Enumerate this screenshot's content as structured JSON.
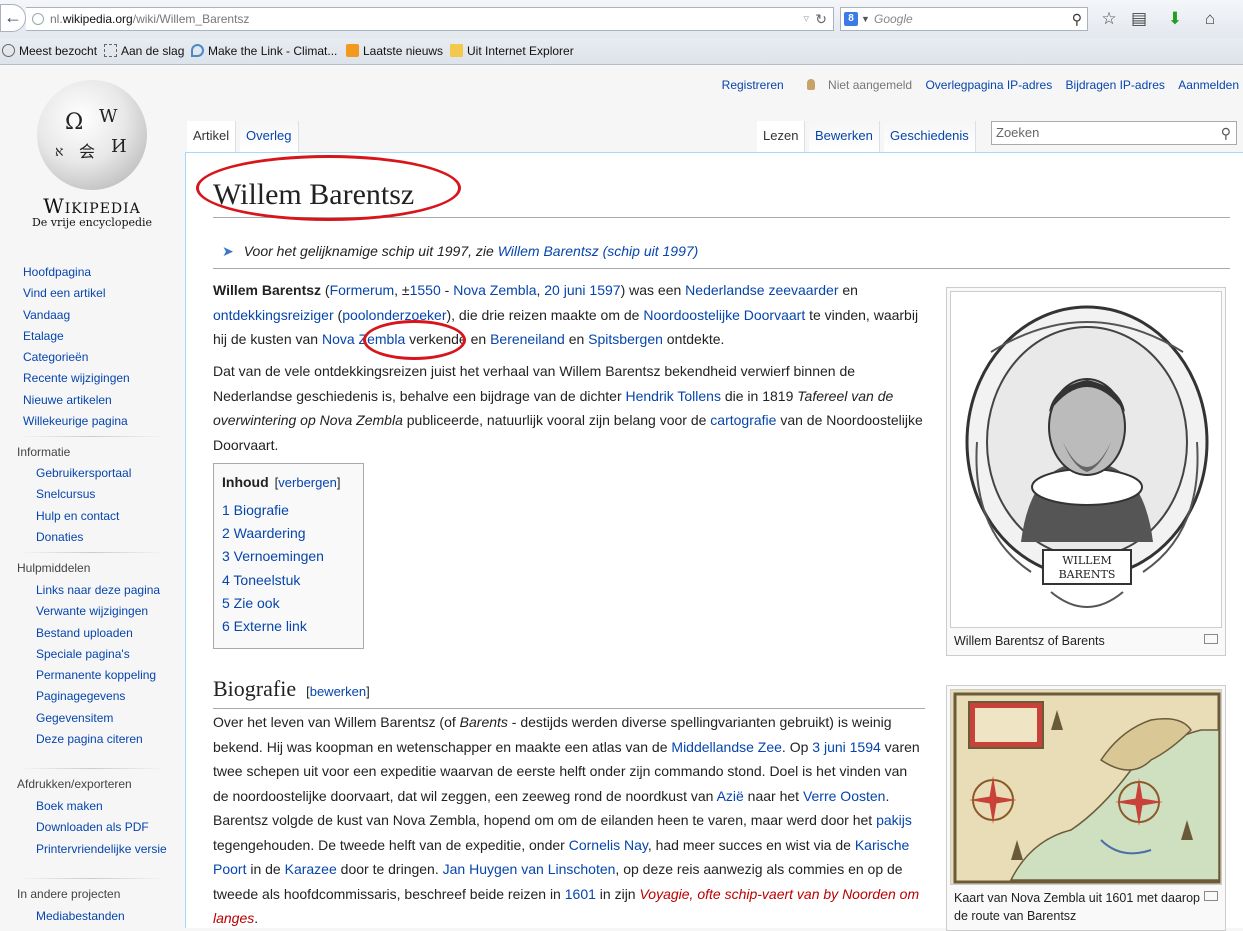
{
  "browser": {
    "url_prefix": "nl.",
    "url_host": "wikipedia.org",
    "url_path": "/wiki/Willem_Barentsz",
    "search_engine": "8",
    "search_placeholder": "Google",
    "bookmarks": [
      "Meest bezocht",
      "Aan de slag",
      "Make the Link - Climat...",
      "Laatste nieuws",
      "Uit Internet Explorer"
    ]
  },
  "logo": {
    "wordmark": "Wikipedia",
    "tagline": "De vrije encyclopedie"
  },
  "nav": {
    "main": [
      "Hoofdpagina",
      "Vind een artikel",
      "Vandaag",
      "Etalage",
      "Categorieën",
      "Recente wijzigingen",
      "Nieuwe artikelen",
      "Willekeurige pagina"
    ],
    "info_head": "Informatie",
    "info": [
      "Gebruikersportaal",
      "Snelcursus",
      "Hulp en contact",
      "Donaties"
    ],
    "tools_head": "Hulpmiddelen",
    "tools": [
      "Links naar deze pagina",
      "Verwante wijzigingen",
      "Bestand uploaden",
      "Speciale pagina's",
      "Permanente koppeling",
      "Paginagegevens",
      "Gegevensitem",
      "Deze pagina citeren"
    ],
    "print_head": "Afdrukken/exporteren",
    "print": [
      "Boek maken",
      "Downloaden als PDF",
      "Printervriendelijke versie"
    ],
    "other_head": "In andere projecten",
    "other": [
      "Mediabestanden"
    ]
  },
  "personal": {
    "register": "Registreren",
    "anon": "Niet aangemeld",
    "talk": "Overlegpagina IP-adres",
    "contribs": "Bijdragen IP-adres",
    "login": "Aanmelden"
  },
  "tabs": {
    "article": "Artikel",
    "talk": "Overleg",
    "read": "Lezen",
    "edit": "Bewerken",
    "history": "Geschiedenis"
  },
  "search": {
    "placeholder": "Zoeken"
  },
  "article": {
    "title": "Willem Barentsz",
    "hatnote_text": "Voor het gelijknamige schip uit 1997, zie ",
    "hatnote_link": "Willem Barentsz (schip uit 1997)",
    "p1": {
      "bold": "Willem Barentsz",
      "t1": " (",
      "l_formerum": "Formerum",
      "t2": ", ±",
      "l_1550": "1550",
      "t3": " - ",
      "l_nz": "Nova Zembla",
      "t4": ", ",
      "l_date": "20 juni",
      "t5": " ",
      "l_1597": "1597",
      "t6": ") was een ",
      "l_zee": "Nederlandse zeevaarder",
      "t7": " en ",
      "l_ont": "ontdekkingsreiziger",
      "t8": " (",
      "l_pool": "poolonderzoeker",
      "t9": "), die drie reizen maakte om de ",
      "l_nood": "Noordoostelijke Doorvaart",
      "t10": " te vinden, waarbij hij de kusten van ",
      "l_nz2": "Nova Zembla",
      "t11": " verkende en ",
      "l_beren": "Bereneiland",
      "t12": " en ",
      "l_spits": "Spitsbergen",
      "t13": " ontdekte."
    },
    "p2": {
      "t1": "Dat van de vele ontdekkingsreizen juist het verhaal van Willem Barentsz bekendheid verwierf binnen de Nederlandse geschiedenis is, behalve een bijdrage van de dichter ",
      "l_tollens": "Hendrik Tollens",
      "t2": " die in 1819 ",
      "italic": "Tafereel van de overwintering op Nova Zembla",
      "t3": " publiceerde, natuurlijk vooral zijn belang voor de ",
      "l_carto": "cartografie",
      "t4": " van de Noordoostelijke Doorvaart."
    },
    "toc": {
      "title": "Inhoud",
      "toggle_open": "[",
      "toggle": "verbergen",
      "toggle_close": "]",
      "items": [
        "1 Biografie",
        "2 Waardering",
        "3 Vernoemingen",
        "4 Toneelstuk",
        "5 Zie ook",
        "6 Externe link"
      ]
    },
    "bio_heading": "Biografie",
    "edit_open": "[",
    "edit": "bewerken",
    "edit_close": "]",
    "p3": {
      "t1": "Over het leven van Willem Barentsz (of ",
      "i1": "Barents",
      "t2": " - destijds werden diverse spellingvarianten gebruikt) is weinig bekend. Hij was koopman en wetenschapper en maakte een atlas van de ",
      "l_mid": "Middellandse Zee",
      "t3": ". Op ",
      "l_date": "3 juni",
      "t4": " ",
      "l_1594": "1594",
      "t5": " varen twee schepen uit voor een expeditie waarvan de eerste helft onder zijn commando stond. Doel is het vinden van de noordoostelijke doorvaart, dat wil zeggen, een zeeweg rond de noordkust van ",
      "l_azie": "Azië",
      "t6": " naar het ",
      "l_verre": "Verre Oosten",
      "t7": ". Barentsz volgde de kust van Nova Zembla, hopend om om de eilanden heen te varen, maar werd door het ",
      "l_pakijs": "pakijs",
      "t8": " tegengehouden. De tweede helft van de expeditie, onder ",
      "l_nay": "Cornelis Nay",
      "t9": ", had meer succes en wist via de ",
      "l_kar": "Karische Poort",
      "t10": " in de ",
      "l_karazee": "Karazee",
      "t11": " door te dringen. ",
      "l_jan": "Jan Huygen van Linschoten",
      "t12": ", op deze reis aanwezig als commies en op de tweede als hoofdcommissaris, beschreef beide reizen in ",
      "l_1601": "1601",
      "t13": " in zijn ",
      "red": "Voyagie, ofte schip-vaert van by Noorden om langes",
      "t14": "."
    },
    "thumb1": {
      "caption": "Willem Barentsz of Barents",
      "plate_line1": "WILLEM",
      "plate_line2": "BARENTS"
    },
    "thumb2": {
      "caption": "Kaart van Nova Zembla uit 1601 met daarop de route van Barentsz"
    }
  },
  "colors": {
    "link": "#0645ad",
    "redlink": "#ba0000",
    "highlight_circle": "#d7151b"
  }
}
